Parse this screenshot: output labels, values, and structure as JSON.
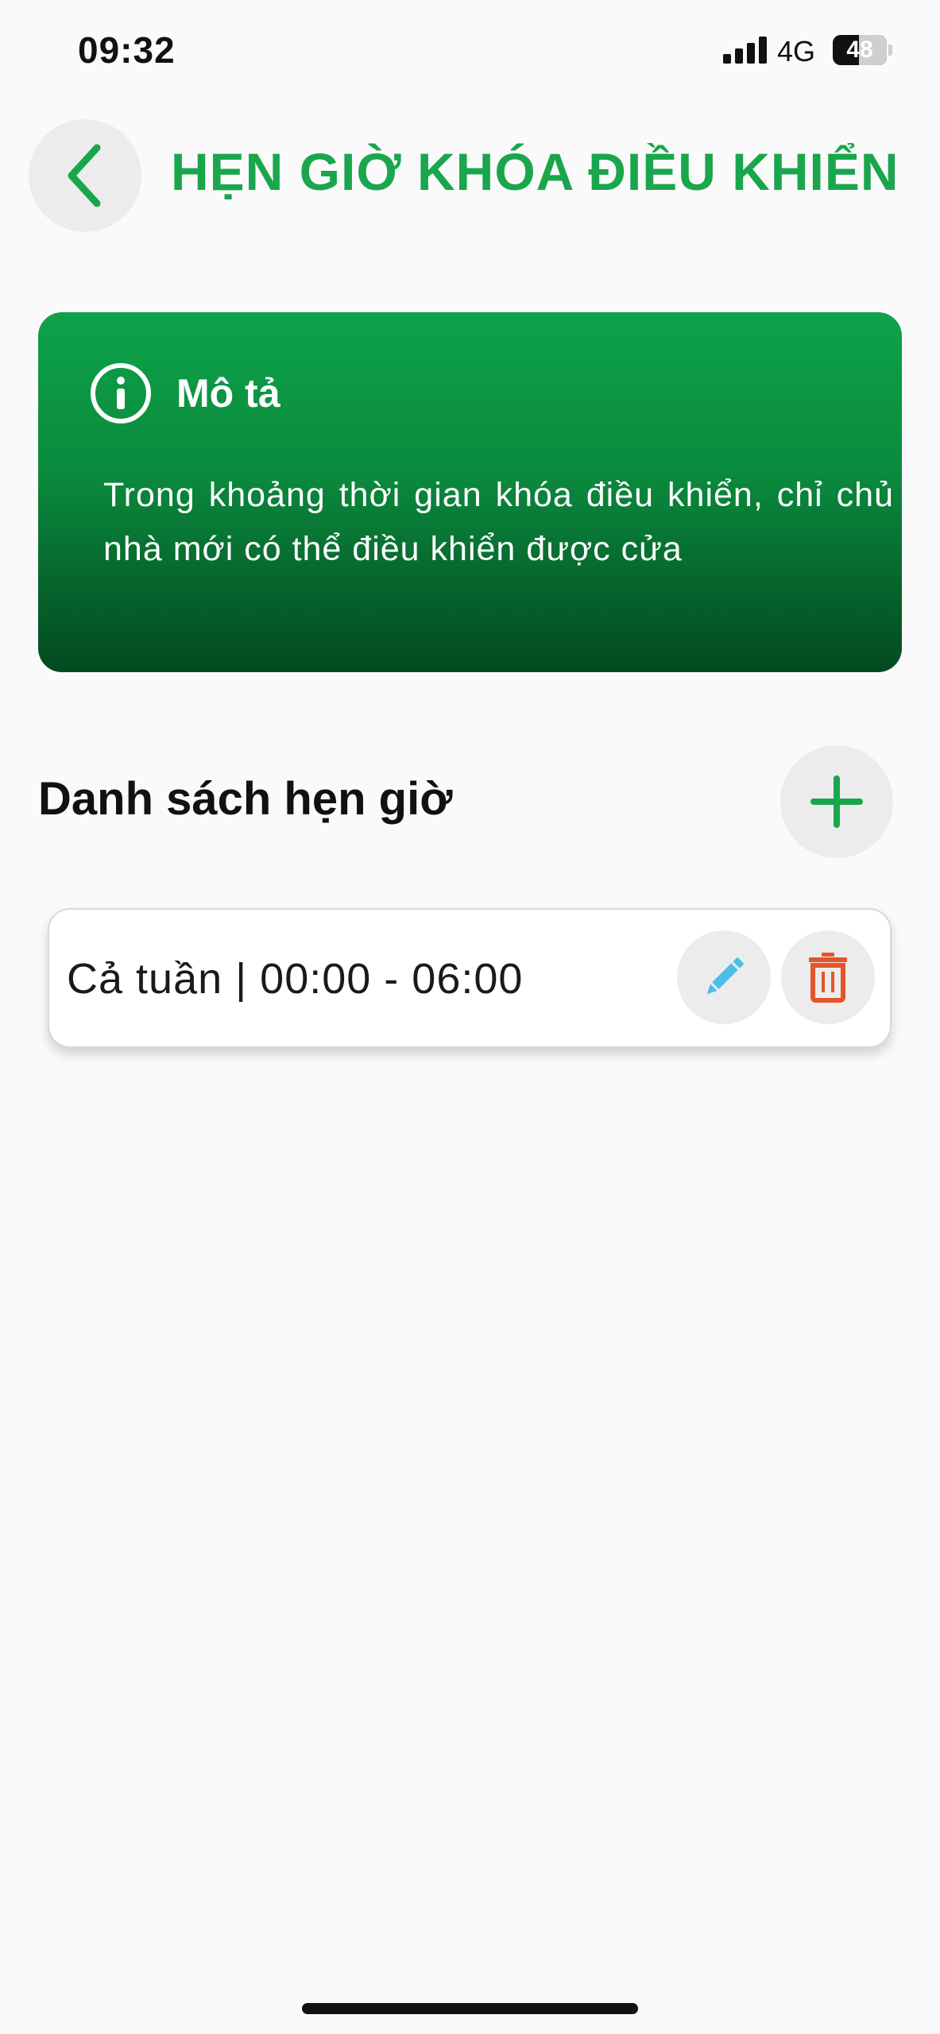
{
  "status_bar": {
    "time": "09:32",
    "network": "4G",
    "battery_label": "48",
    "battery_level": 0.48
  },
  "header": {
    "title": "HẸN GIỜ KHÓA ĐIỀU KHIỂN",
    "back_icon": "chevron-left-icon"
  },
  "description": {
    "title": "Mô tả",
    "icon": "info-icon",
    "text": "Trong khoảng thời gian khóa điều khiển, chỉ chủ nhà mới có thể điều khiển được cửa"
  },
  "schedule_list": {
    "title": "Danh sách hẹn giờ",
    "add_icon": "plus-icon",
    "items": [
      {
        "label": "Cả tuần | 00:00 - 06:00",
        "edit_icon": "pencil-icon",
        "delete_icon": "trash-icon"
      }
    ]
  },
  "colors": {
    "accent": "#1aa64c",
    "card_gradient_top": "#0ea24a",
    "card_gradient_bottom": "#034a20",
    "edit_icon": "#4dbde8",
    "delete_icon": "#e3562b",
    "button_background": "#ececec"
  }
}
